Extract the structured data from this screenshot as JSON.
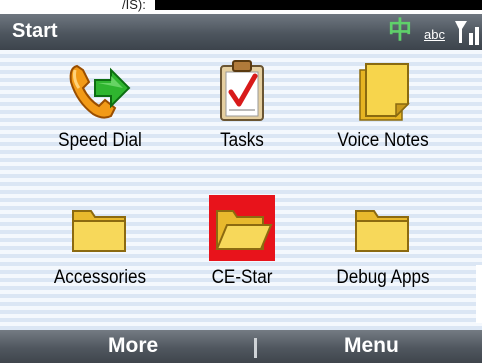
{
  "top_cut_text": "/IS):",
  "header": {
    "title": "Start",
    "ime_indicator": "中",
    "input_mode": "abc"
  },
  "tiles": [
    {
      "label": "Speed Dial",
      "icon": "speed-dial-phone-icon",
      "selected": false
    },
    {
      "label": "Tasks",
      "icon": "tasks-clipboard-icon",
      "selected": false
    },
    {
      "label": "Voice Notes",
      "icon": "voice-notes-sticky-note-icon",
      "selected": false
    },
    {
      "label": "Accessories",
      "icon": "folder-icon",
      "selected": false
    },
    {
      "label": "CE-Star",
      "icon": "open-folder-icon",
      "selected": true
    },
    {
      "label": "Debug Apps",
      "icon": "folder-icon",
      "selected": false
    }
  ],
  "softkeys": {
    "left": "More",
    "right": "Menu"
  },
  "colors": {
    "selection": "#e8131b",
    "ime_green": "#5fd06a",
    "folder_yellow": "#f3cf3b"
  }
}
